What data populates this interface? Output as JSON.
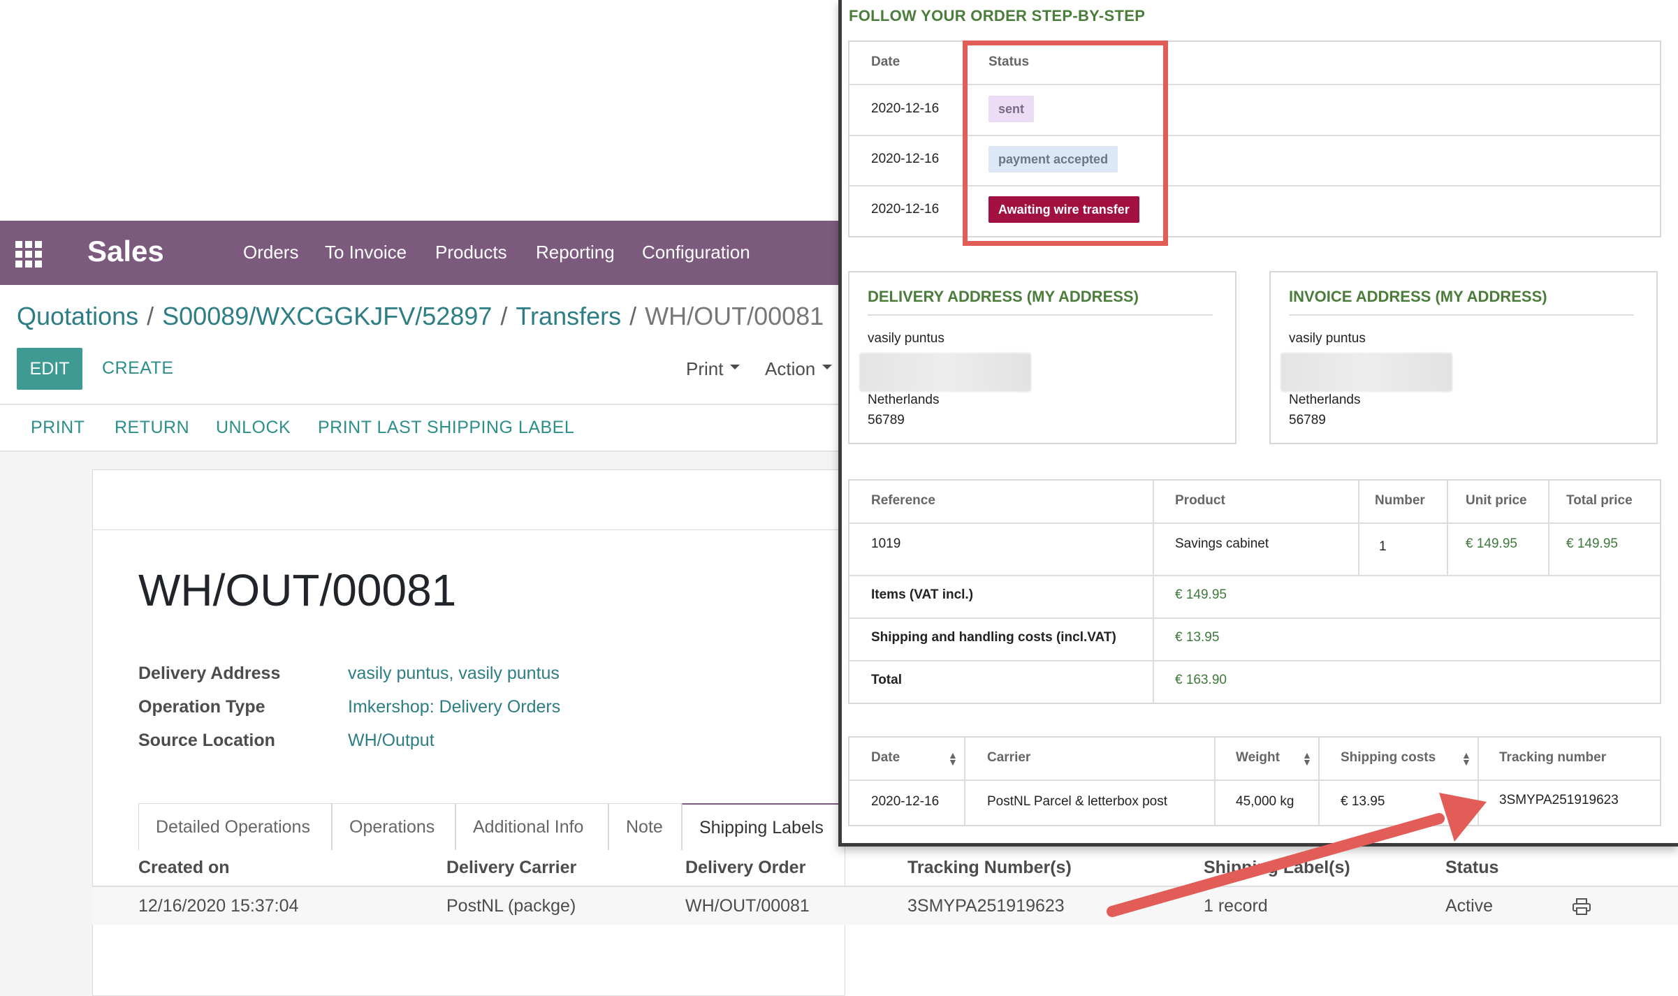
{
  "navbar": {
    "app_name": "Sales",
    "menu": [
      "Orders",
      "To Invoice",
      "Products",
      "Reporting",
      "Configuration"
    ]
  },
  "breadcrumb": {
    "items": [
      "Quotations",
      "S00089/WXCGGKJFV/52897",
      "Transfers"
    ],
    "current": "WH/OUT/00081",
    "separator": "/"
  },
  "control_panel": {
    "edit": "EDIT",
    "create": "CREATE",
    "print": "Print",
    "action": "Action"
  },
  "statusbar": {
    "buttons": [
      "PRINT",
      "RETURN",
      "UNLOCK",
      "PRINT LAST SHIPPING LABEL"
    ]
  },
  "record": {
    "title": "WH/OUT/00081",
    "fields": [
      {
        "label": "Delivery Address",
        "value": "vasily puntus, vasily puntus"
      },
      {
        "label": "Operation Type",
        "value": "Imkershop: Delivery Orders"
      },
      {
        "label": "Source Location",
        "value": "WH/Output"
      }
    ]
  },
  "tabs": [
    "Detailed Operations",
    "Operations",
    "Additional Info",
    "Note",
    "Shipping Labels"
  ],
  "active_tab": "Shipping Labels",
  "shipping_labels": {
    "columns": [
      "Created on",
      "Delivery Carrier",
      "Delivery Order",
      "Tracking Number(s)",
      "Shipping Label(s)",
      "Status"
    ],
    "rows": [
      [
        "12/16/2020 15:37:04",
        "PostNL (packge)",
        "WH/OUT/00081",
        "3SMYPA251919623",
        "1 record",
        "Active"
      ]
    ],
    "row_icon": "printer-icon"
  },
  "portal": {
    "title": "FOLLOW YOUR ORDER STEP-BY-STEP",
    "history": {
      "columns": [
        "Date",
        "Status"
      ],
      "rows": [
        {
          "date": "2020-12-16",
          "status": "sent"
        },
        {
          "date": "2020-12-16",
          "status": "payment accepted"
        },
        {
          "date": "2020-12-16",
          "status": "Awaiting wire transfer"
        }
      ]
    },
    "delivery_address": {
      "title": "DELIVERY ADDRESS (MY ADDRESS)",
      "name": "vasily puntus",
      "country": "Netherlands",
      "zip": "56789"
    },
    "invoice_address": {
      "title": "INVOICE ADDRESS (MY ADDRESS)",
      "name": "vasily puntus",
      "country": "Netherlands",
      "zip": "56789"
    },
    "products": {
      "columns": [
        "Reference",
        "Product",
        "Number",
        "Unit price",
        "Total price"
      ],
      "row": [
        "1019",
        "Savings cabinet",
        "1",
        "€ 149.95",
        "€ 149.95"
      ],
      "items_label": "Items (VAT incl.)",
      "items_value": "€ 149.95",
      "shipping_label": "Shipping and handling costs (incl.VAT)",
      "shipping_value": "€ 13.95",
      "total_label": "Total",
      "total_value": "€ 163.90"
    },
    "carrier": {
      "columns": [
        "Date",
        "Carrier",
        "Weight",
        "Shipping costs",
        "Tracking number"
      ],
      "row": [
        "2020-12-16",
        "PostNL Parcel & letterbox post",
        "45,000 kg",
        "€ 13.95",
        "3SMYPA251919623"
      ]
    }
  },
  "colors": {
    "navbar": "#7c5a7e",
    "primary": "#3e9a93",
    "link": "#2d7d84",
    "portal_green": "#4a7c3a",
    "highlight": "#e25d57",
    "awaiting_badge": "#a1103f"
  }
}
